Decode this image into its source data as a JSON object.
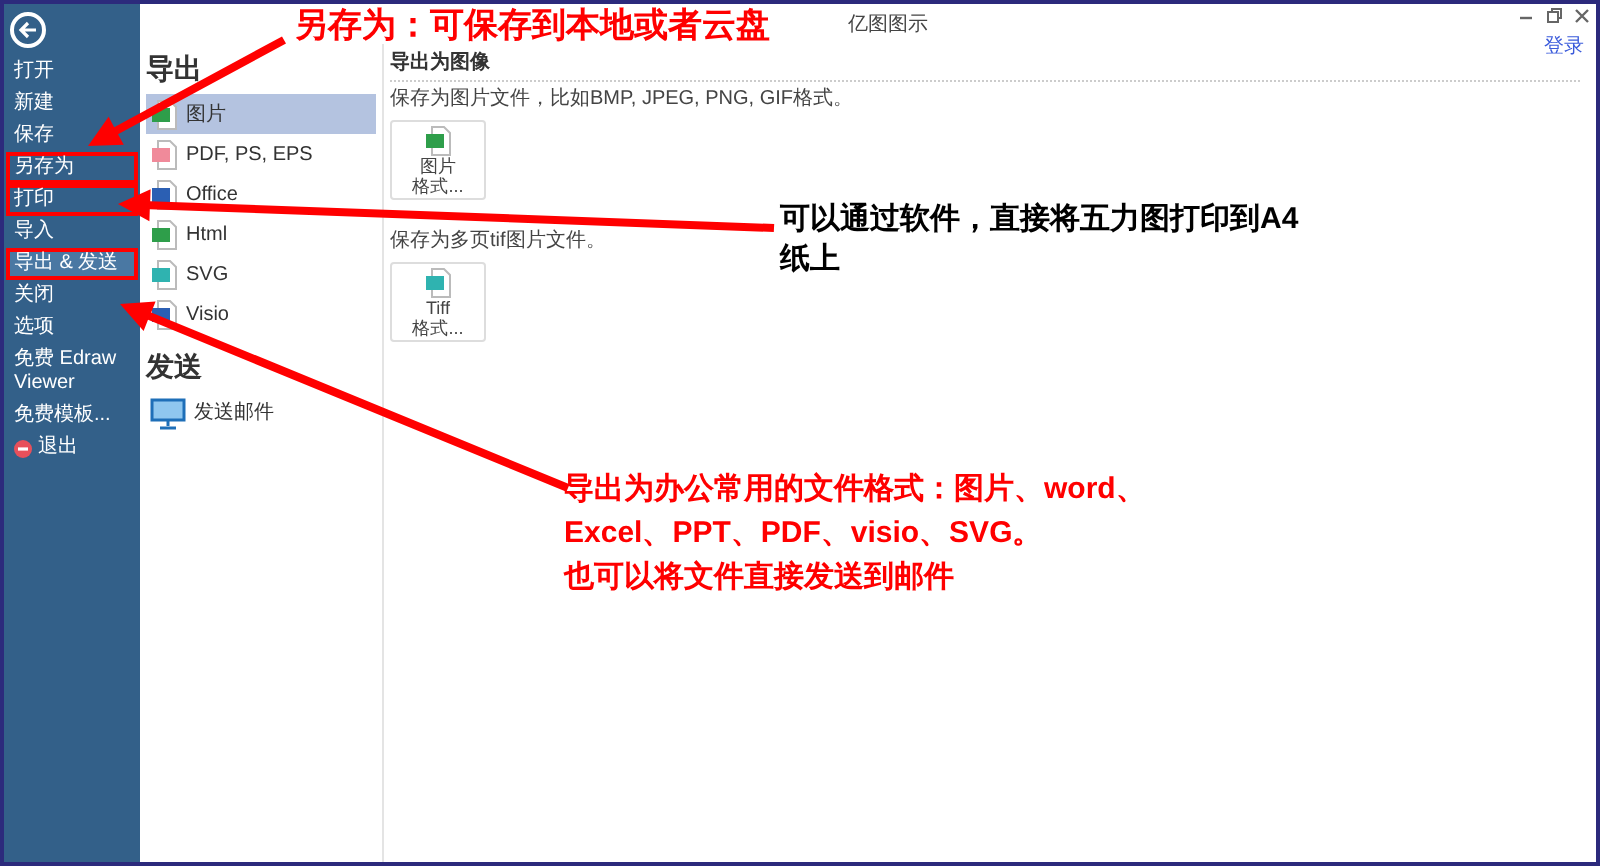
{
  "window": {
    "title": "亿图图示",
    "login_link": "登录"
  },
  "sidebar": {
    "items": [
      {
        "label": "打开",
        "selected": false,
        "highlighted": false,
        "kind": "plain"
      },
      {
        "label": "新建",
        "selected": false,
        "highlighted": false,
        "kind": "plain"
      },
      {
        "label": "保存",
        "selected": false,
        "highlighted": false,
        "kind": "plain"
      },
      {
        "label": "另存为",
        "selected": false,
        "highlighted": true,
        "kind": "plain"
      },
      {
        "label": "打印",
        "selected": false,
        "highlighted": true,
        "kind": "plain"
      },
      {
        "label": "导入",
        "selected": false,
        "highlighted": false,
        "kind": "plain"
      },
      {
        "label": "导出 & 发送",
        "selected": true,
        "highlighted": true,
        "kind": "plain"
      },
      {
        "label": "关闭",
        "selected": false,
        "highlighted": false,
        "kind": "plain"
      },
      {
        "label": "选项",
        "selected": false,
        "highlighted": false,
        "kind": "plain"
      },
      {
        "label": "免费 Edraw Viewer",
        "selected": false,
        "highlighted": false,
        "kind": "plain"
      },
      {
        "label": "免费模板...",
        "selected": false,
        "highlighted": false,
        "kind": "plain"
      },
      {
        "label": "退出",
        "selected": false,
        "highlighted": false,
        "kind": "exit"
      }
    ]
  },
  "export_section": {
    "heading": "导出",
    "items": [
      {
        "label": "图片",
        "selected": true,
        "color": "#2e9e4a"
      },
      {
        "label": "PDF, PS, EPS",
        "selected": false,
        "color": "#f08a9a"
      },
      {
        "label": "Office",
        "selected": false,
        "color": "#2b5fb3"
      },
      {
        "label": "Html",
        "selected": false,
        "color": "#2e9e4a"
      },
      {
        "label": "SVG",
        "selected": false,
        "color": "#2fb3b0"
      },
      {
        "label": "Visio",
        "selected": false,
        "color": "#2b5fb3"
      }
    ]
  },
  "send_section": {
    "heading": "发送",
    "items": [
      {
        "label": "发送邮件",
        "selected": false
      }
    ]
  },
  "detail_panel": {
    "title": "导出为图像",
    "groups": [
      {
        "description": "保存为图片文件，比如BMP, JPEG, PNG, GIF格式。",
        "tile": {
          "lines": [
            "图片",
            "格式..."
          ],
          "color": "#2e9e4a"
        }
      },
      {
        "description": "保存为多页tif图片文件。",
        "tile": {
          "lines": [
            "Tiff",
            "格式..."
          ],
          "color": "#2fb3b0"
        }
      }
    ]
  },
  "annotations": [
    {
      "lines": [
        "另存为：可保存到本地或者云盘"
      ],
      "color": "#ff0000"
    },
    {
      "lines": [
        "可以通过软件，直接将五力图打印到A4",
        "纸上"
      ],
      "color": "#000000"
    },
    {
      "lines": [
        "导出为办公常用的文件格式：图片、word、",
        "Excel、PPT、PDF、visio、SVG。",
        "也可以将文件直接发送到邮件"
      ],
      "color": "#ff0000"
    }
  ]
}
